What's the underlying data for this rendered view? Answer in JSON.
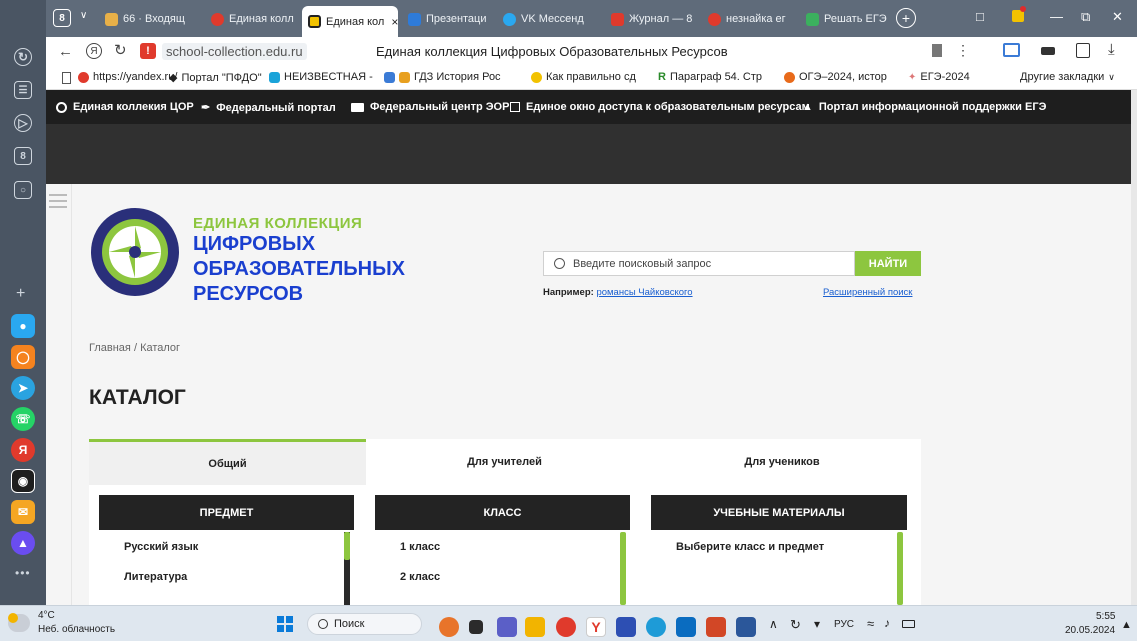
{
  "browser": {
    "tab_count_badge": "8",
    "tabs": [
      {
        "label": "66 · Входящ",
        "color": "#e8b048"
      },
      {
        "label": "Единая колл",
        "color": "#e03a2c"
      },
      {
        "label": "Единая кол",
        "color": "#f2c200"
      },
      {
        "label": "Презентаци",
        "color": "#2e7bd9"
      },
      {
        "label": "VK Мессенд",
        "color": "#2aa8f0"
      },
      {
        "label": "Журнал — 8",
        "color": "#e03a2c"
      },
      {
        "label": "незнайка ег",
        "color": "#e03a2c"
      },
      {
        "label": "Решать ЕГЭ",
        "color": "#3bb05e"
      }
    ],
    "domain": "school-collection.edu.ru",
    "page_title": "Единая коллекция Цифровых Образовательных Ресурсов",
    "bookmarks": [
      "https://yandex.ru/",
      "Портал \"ПФДО\"",
      "НЕИЗВЕСТНАЯ -",
      "ГДЗ История Рос",
      "Как правильно сд",
      "Параграф 54. Стр",
      "ОГЭ–2024, истор",
      "ЕГЭ-2024"
    ],
    "other_bookmarks": "Другие закладки"
  },
  "site": {
    "topnav": [
      "Единая коллекия ЦОР",
      "Федеральный портал",
      "Федеральный центр ЭОР",
      "Единое окно доступа к образовательным ресурсам",
      "Портал информационной поддержки ЕГЭ"
    ],
    "logo_line1": "ЕДИНАЯ КОЛЛЕКЦИЯ",
    "logo_line2": "ЦИФРОВЫХ",
    "logo_line3": "ОБРАЗОВАТЕЛЬНЫХ",
    "logo_line4": "РЕСУРСОВ",
    "search_placeholder": "Введите поисковый запрос",
    "search_button": "НАЙТИ",
    "example_prefix": "Например:",
    "example_link": "романсы Чайковского",
    "advanced_search": "Расширенный поиск",
    "breadcrumb_home": "Главная",
    "breadcrumb_sep": "/",
    "breadcrumb_current": "Каталог",
    "heading": "КАТАЛОГ",
    "tabs": [
      "Общий",
      "Для учителей",
      "Для учеников"
    ],
    "columns": {
      "subject": {
        "header": "ПРЕДМЕТ",
        "items": [
          "Русский язык",
          "Литература"
        ]
      },
      "grade": {
        "header": "КЛАСС",
        "items": [
          "1 класс",
          "2 класс"
        ]
      },
      "materials": {
        "header": "УЧЕБНЫЕ МАТЕРИАЛЫ",
        "items": [
          "Выберите класс и предмет"
        ]
      }
    },
    "accent_color": "#8dc63f",
    "brand_blue": "#1a3fcf"
  },
  "taskbar": {
    "weather_temp": "4°C",
    "weather_text": "Неб. облачность",
    "search_label": "Поиск",
    "lang": "РУС",
    "time": "5:55",
    "date": "20.05.2024"
  }
}
